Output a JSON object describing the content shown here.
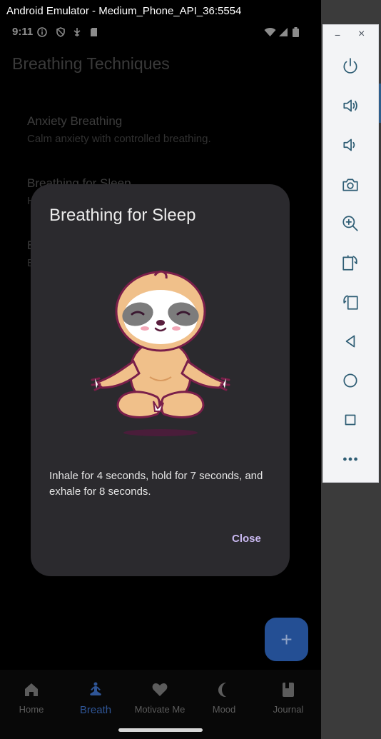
{
  "window": {
    "title": "Android Emulator - Medium_Phone_API_36:5554"
  },
  "status_bar": {
    "time": "9:11"
  },
  "app": {
    "title": "Breathing Techniques",
    "techniques": [
      {
        "title": "Anxiety Breathing",
        "subtitle": "Calm anxiety with controlled breathing."
      },
      {
        "title": "Breathing for Sleep",
        "subtitle": "H"
      },
      {
        "title": "B",
        "subtitle": "E"
      }
    ]
  },
  "dialog": {
    "title": "Breathing for Sleep",
    "illustration": "meditating-sloth",
    "body": "Inhale for 4 seconds, hold for 7 seconds, and exhale for 8 seconds.",
    "close_label": "Close"
  },
  "fab": {
    "label": "+"
  },
  "bottom_nav": {
    "items": [
      {
        "label": "Home",
        "icon": "home-icon"
      },
      {
        "label": "Breath",
        "icon": "meditation-icon",
        "active": true
      },
      {
        "label": "Motivate Me",
        "icon": "heart-icon"
      },
      {
        "label": "Mood",
        "icon": "moon-icon"
      },
      {
        "label": "Journal",
        "icon": "book-icon"
      }
    ]
  },
  "emulator_toolbar": {
    "window_controls": [
      "−",
      "×"
    ],
    "tools": [
      "power-icon",
      "volume-up-icon",
      "volume-down-icon",
      "camera-icon",
      "zoom-icon",
      "rotate-right-icon",
      "rotate-left-icon",
      "back-icon",
      "home-circle-icon",
      "overview-icon",
      "more-icon"
    ]
  },
  "colors": {
    "accent": "#244f94",
    "dialog_bg": "#2b2a2e",
    "close_text": "#c9b8f0",
    "nav_active": "#2f5596"
  }
}
